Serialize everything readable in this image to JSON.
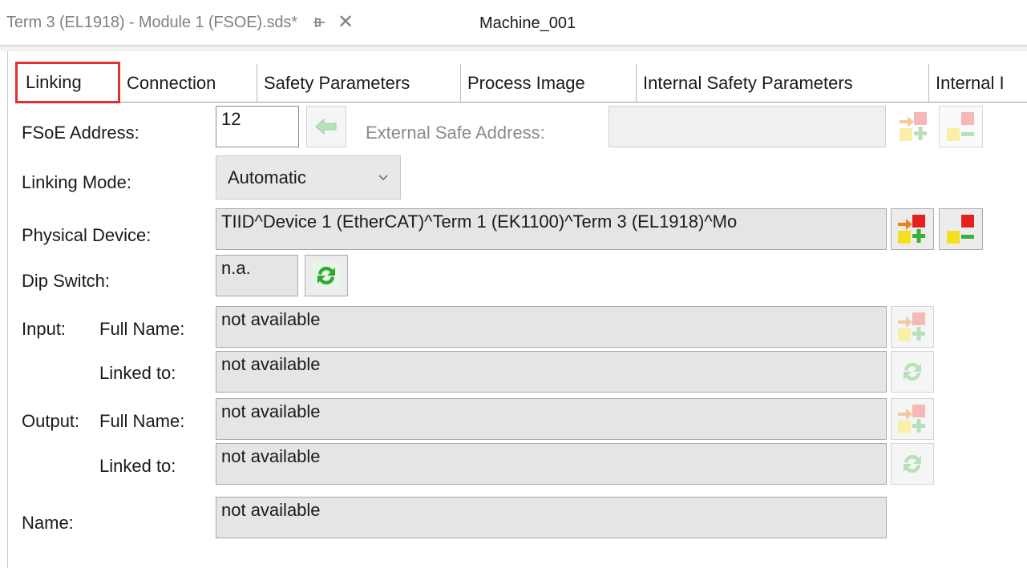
{
  "document_tabs": {
    "active_title": "Term 3 (EL1918) - Module 1 (FSOE).sds*",
    "pin_glyph": "⊣",
    "close_glyph": "✕",
    "second_title": "Machine_001"
  },
  "tabs": [
    {
      "label": "Linking",
      "active": true
    },
    {
      "label": "Connection"
    },
    {
      "label": "Safety Parameters"
    },
    {
      "label": "Process Image"
    },
    {
      "label": "Internal Safety Parameters"
    },
    {
      "label": "Internal I"
    }
  ],
  "fsoe_address": {
    "label": "FSoE Address:",
    "value": "12",
    "external_label": "External Safe Address:",
    "external_value": ""
  },
  "linking_mode": {
    "label": "Linking Mode:",
    "value": "Automatic"
  },
  "physical_device": {
    "label": "Physical Device:",
    "value": "TIID^Device 1 (EtherCAT)^Term 1 (EK1100)^Term 3 (EL1918)^Mo"
  },
  "dip_switch": {
    "label": "Dip Switch:",
    "value": "n.a."
  },
  "input": {
    "group_label": "Input:",
    "full_name_label": "Full Name:",
    "full_name_value": "not available",
    "linked_to_label": "Linked to:",
    "linked_to_value": "not available"
  },
  "output": {
    "group_label": "Output:",
    "full_name_label": "Full Name:",
    "full_name_value": "not available",
    "linked_to_label": "Linked to:",
    "linked_to_value": "not available"
  },
  "name": {
    "label": "Name:",
    "value": "not available"
  },
  "colors": {
    "active_tab_outline": "#e03030",
    "link_icon_red": "#e52020",
    "link_icon_yellow": "#f5e020",
    "link_icon_green": "#3ab03a"
  }
}
